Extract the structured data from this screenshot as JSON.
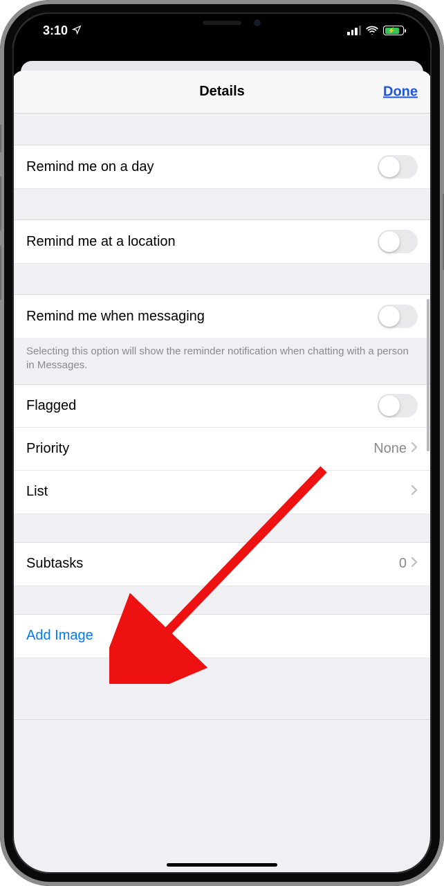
{
  "statusbar": {
    "time": "3:10"
  },
  "navbar": {
    "title": "Details",
    "done": "Done"
  },
  "rows": {
    "remind_day": "Remind me on a day",
    "remind_location": "Remind me at a location",
    "remind_messaging": "Remind me when messaging",
    "messaging_footnote": "Selecting this option will show the reminder notification when chatting with a person in Messages.",
    "flagged": "Flagged",
    "priority": "Priority",
    "priority_value": "None",
    "list": "List",
    "subtasks": "Subtasks",
    "subtasks_value": "0",
    "add_image": "Add Image"
  }
}
